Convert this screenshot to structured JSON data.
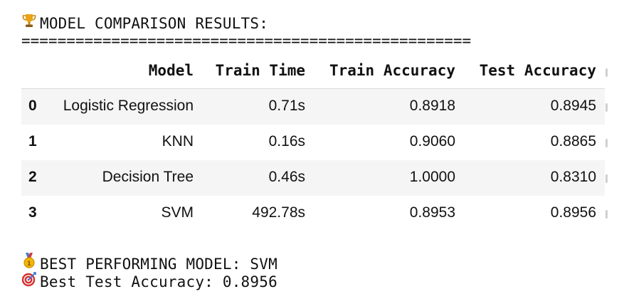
{
  "output": {
    "header": {
      "icon": "trophy-icon",
      "text": "MODEL COMPARISON RESULTS:"
    },
    "separator": "==================================================",
    "table": {
      "columns": [
        "Model",
        "Train Time",
        "Train Accuracy",
        "Test Accuracy"
      ],
      "rows": [
        {
          "index": "0",
          "model": "Logistic Regression",
          "train_time": "0.71s",
          "train_accuracy": "0.8918",
          "test_accuracy": "0.8945"
        },
        {
          "index": "1",
          "model": "KNN",
          "train_time": "0.16s",
          "train_accuracy": "0.9060",
          "test_accuracy": "0.8865"
        },
        {
          "index": "2",
          "model": "Decision Tree",
          "train_time": "0.46s",
          "train_accuracy": "1.0000",
          "test_accuracy": "0.8310"
        },
        {
          "index": "3",
          "model": "SVM",
          "train_time": "492.78s",
          "train_accuracy": "0.8953",
          "test_accuracy": "0.8956"
        }
      ]
    },
    "best_model": {
      "icon": "medal-icon",
      "text": "BEST PERFORMING MODEL: SVM"
    },
    "best_accuracy": {
      "icon": "target-icon",
      "text": "Best Test Accuracy: 0.8956"
    }
  }
}
